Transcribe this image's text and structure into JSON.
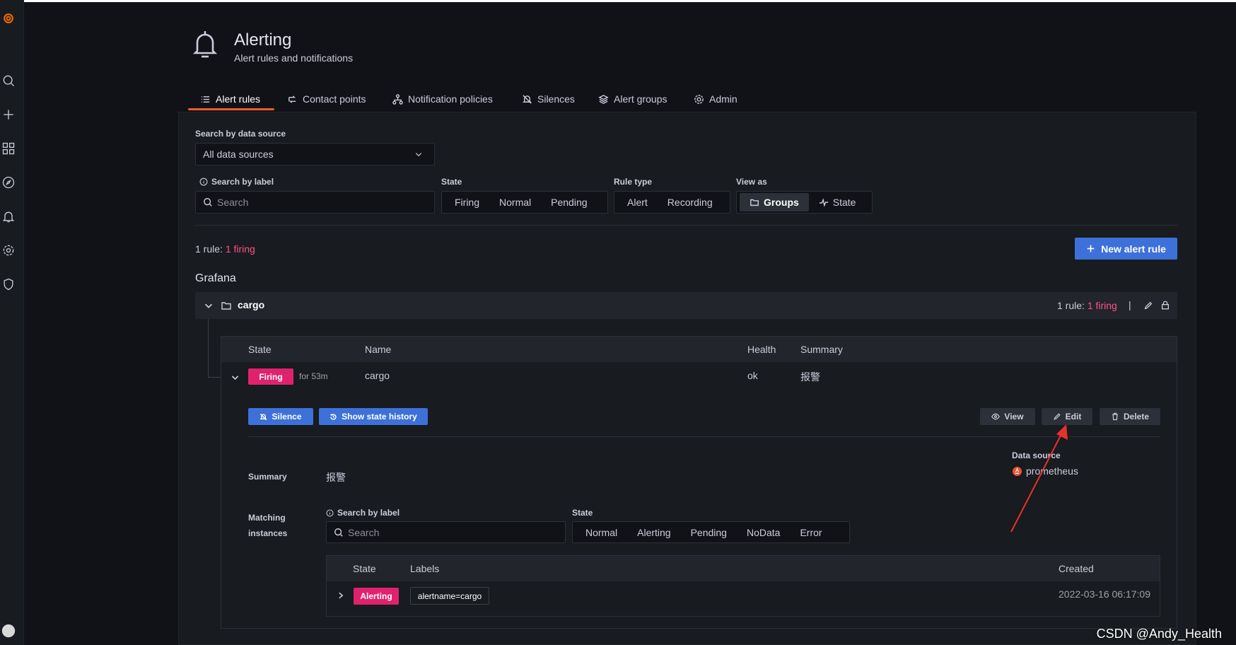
{
  "header": {
    "title": "Alerting",
    "subtitle": "Alert rules and notifications"
  },
  "tabs": [
    {
      "label": "Alert rules",
      "icon": "list-icon",
      "active": true
    },
    {
      "label": "Contact points",
      "icon": "contact-points-icon"
    },
    {
      "label": "Notification policies",
      "icon": "sitemap-icon"
    },
    {
      "label": "Silences",
      "icon": "bell-slash-icon"
    },
    {
      "label": "Alert groups",
      "icon": "layers-icon"
    },
    {
      "label": "Admin",
      "icon": "cog-icon"
    }
  ],
  "filters": {
    "datasource_label": "Search by data source",
    "datasource_value": "All data sources",
    "search_label": "Search by label",
    "search_placeholder": "Search",
    "state_label": "State",
    "state_options": [
      "Firing",
      "Normal",
      "Pending"
    ],
    "rule_type_label": "Rule type",
    "rule_type_options": [
      "Alert",
      "Recording"
    ],
    "view_as_label": "View as",
    "view_as_options": [
      "Groups",
      "State"
    ],
    "view_as_selected": "Groups"
  },
  "summary": {
    "prefix": "1 rule:",
    "firing": "1 firing"
  },
  "new_rule_button": "New alert rule",
  "section_title": "Grafana",
  "group": {
    "name": "cargo",
    "count_prefix": "1 rule:",
    "count_firing": "1 firing",
    "separator": "|"
  },
  "rules_table": {
    "headers": [
      "State",
      "Name",
      "Health",
      "Summary"
    ],
    "row": {
      "state": "Firing",
      "duration": "for 53m",
      "name": "cargo",
      "health": "ok",
      "summary": "报警"
    }
  },
  "rule_actions": {
    "silence": "Silence",
    "history": "Show state history",
    "view": "View",
    "edit": "Edit",
    "delete": "Delete"
  },
  "rule_details": {
    "summary_label": "Summary",
    "summary_value": "报警",
    "datasource_label": "Data source",
    "datasource_value": "prometheus",
    "matching_label_1": "Matching",
    "matching_label_2": "instances",
    "search_label": "Search by label",
    "search_placeholder": "Search",
    "state_label": "State",
    "state_options": [
      "Normal",
      "Alerting",
      "Pending",
      "NoData",
      "Error"
    ]
  },
  "instances_table": {
    "headers": [
      "State",
      "Labels",
      "Created"
    ],
    "row": {
      "state": "Alerting",
      "label": "alertname=cargo",
      "created": "2022-03-16 06:17:09"
    }
  },
  "watermark": "CSDN @Andy_Health",
  "colors": {
    "firing": "#e0226e",
    "firing_text": "#ff5286",
    "primary": "#3d71d9",
    "tab_accent": "#f05a28",
    "annotation_arrow": "#e8302f"
  }
}
